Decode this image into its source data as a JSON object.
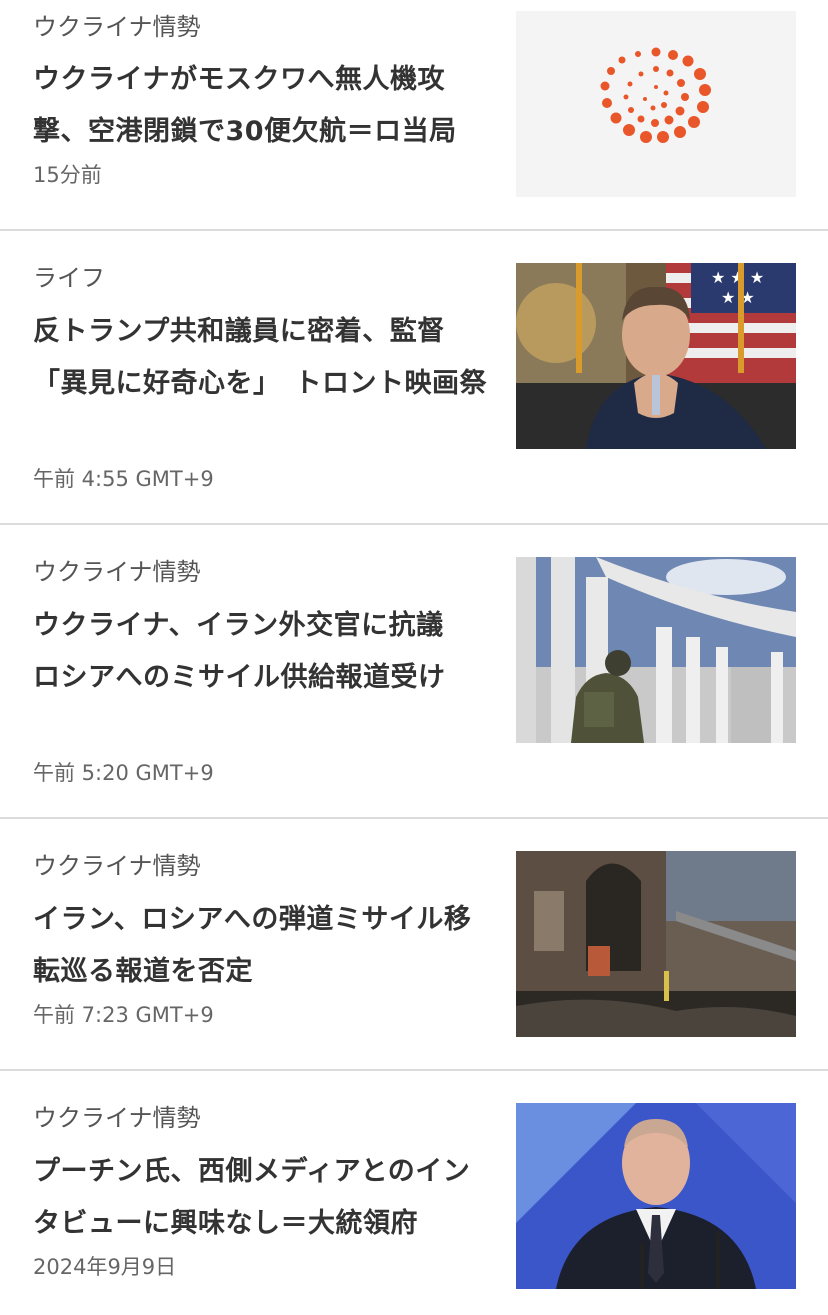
{
  "stories": [
    {
      "category": "ウクライナ情勢",
      "headline": "ウクライナがモスクワへ無人機攻撃、空港閉鎖で30便欠航＝ロ当局",
      "timestamp": "15分前",
      "thumbnail": "reuters-logo-placeholder"
    },
    {
      "category": "ライフ",
      "headline": "反トランプ共和議員に密着、監督「異見に好奇心を」　トロント映画祭",
      "timestamp": "午前 4:55 GMT+9",
      "thumbnail": "man-in-suit-with-flags-photo"
    },
    {
      "category": "ウクライナ情勢",
      "headline": "ウクライナ、イラン外交官に抗議　ロシアへのミサイル供給報道受け",
      "timestamp": "午前 5:20 GMT+9",
      "thumbnail": "soldier-at-colonnade-photo"
    },
    {
      "category": "ウクライナ情勢",
      "headline": "イラン、ロシアへの弾道ミサイル移転巡る報道を否定",
      "timestamp": "午前 7:23 GMT+9",
      "thumbnail": "damaged-building-photo"
    },
    {
      "category": "ウクライナ情勢",
      "headline": "プーチン氏、西側メディアとのインタビューに興味なし＝大統領府",
      "timestamp": "2024年9月9日",
      "thumbnail": "putin-speaking-photo"
    }
  ],
  "colors": {
    "logo_orange": "#e8562a",
    "divider": "#dcdcdc",
    "headline": "#333333",
    "meta": "#666666"
  }
}
